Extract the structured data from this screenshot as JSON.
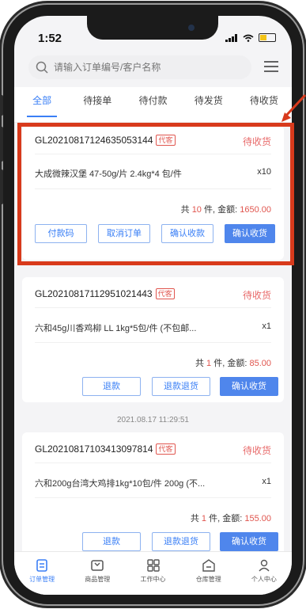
{
  "status_bar": {
    "time": "1:52"
  },
  "search": {
    "placeholder": "请输入订单编号/客户名称"
  },
  "tabs": [
    {
      "label": "全部"
    },
    {
      "label": "待接单"
    },
    {
      "label": "待付款"
    },
    {
      "label": "待发货"
    },
    {
      "label": "待收货"
    }
  ],
  "orders": [
    {
      "order_no": "GL20210817124635053144",
      "tag": "代客",
      "status": "待收货",
      "product": "大成微辣汉堡  47-50g/片  2.4kg*4 包/件",
      "qty": "x10",
      "summary_prefix": "共",
      "count": "10",
      "summary_mid": "件, 金额:",
      "amount": "1650.00",
      "buttons": [
        "付款码",
        "取消订单",
        "确认收款",
        "确认收货"
      ]
    },
    {
      "order_no": "GL20210817112951021443",
      "tag": "代客",
      "status": "待收货",
      "product": "六和45g川香鸡柳 LL  1kg*5包/件  (不包邮...",
      "qty": "x1",
      "summary_prefix": "共",
      "count": "1",
      "summary_mid": "件, 金额:",
      "amount": "85.00",
      "buttons": [
        "退款",
        "退款退货",
        "确认收货"
      ]
    },
    {
      "timestamp": "2021.08.17 11:29:51",
      "order_no": "GL20210817103413097814",
      "tag": "代客",
      "status": "待收货",
      "product": "六和200g台湾大鸡排1kg*10包/件 200g (不...",
      "qty": "x1",
      "summary_prefix": "共",
      "count": "1",
      "summary_mid": "件, 金额:",
      "amount": "155.00",
      "buttons": [
        "退款",
        "退款退货",
        "确认收货"
      ]
    }
  ],
  "bottom_nav": [
    {
      "label": "订单管理",
      "icon": "order-icon"
    },
    {
      "label": "商品管理",
      "icon": "product-icon"
    },
    {
      "label": "工作中心",
      "icon": "grid-icon"
    },
    {
      "label": "仓库管理",
      "icon": "warehouse-icon"
    },
    {
      "label": "个人中心",
      "icon": "user-icon"
    }
  ],
  "colors": {
    "accent": "#3a7ff6",
    "status": "#e86a6a",
    "highlight": "#d83a1c"
  }
}
